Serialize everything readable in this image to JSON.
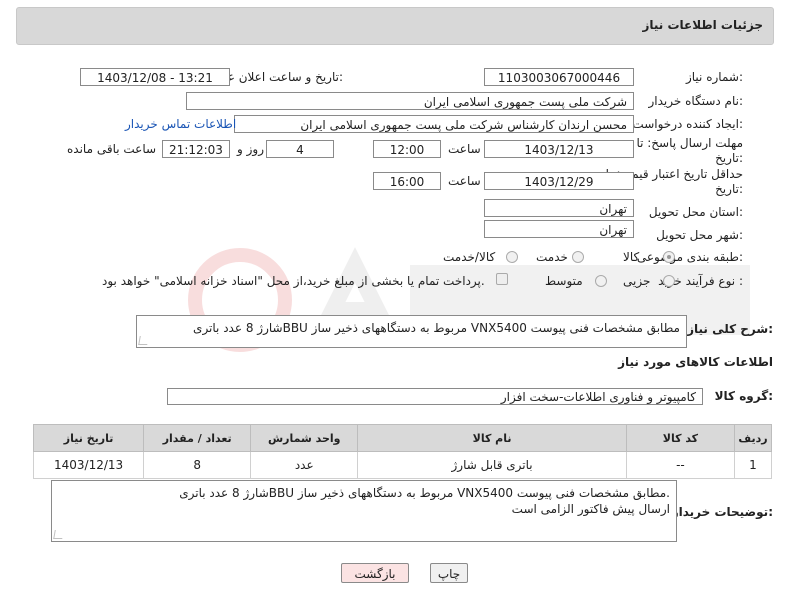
{
  "header": {
    "title": "جزئیات اطلاعات نیاز"
  },
  "fields": {
    "need_number_label": "شماره نیاز:",
    "need_number": "1103003067000446",
    "announce_label": "تاریخ و ساعت اعلان عمومی:",
    "announce_value": "1403/12/08 - 13:21",
    "buyer_label": "نام دستگاه خریدار:",
    "buyer_value": "شرکت ملی پست جمهوری اسلامی ایران",
    "requester_label": "ایجاد کننده درخواست:",
    "requester_value": "محسن ارندان کارشناس شرکت ملی پست جمهوری اسلامی ایران",
    "contact_link": "اطلاعات تماس خریدار",
    "deadline_label": "مهلت ارسال پاسخ: تا تاریخ:",
    "deadline_date": "1403/12/13",
    "time_label": "ساعت",
    "deadline_time": "12:00",
    "days_value": "4",
    "days_label": "روز و",
    "remaining_time": "21:12:03",
    "remaining_label": "ساعت باقی مانده",
    "validity_label": "حداقل تاریخ اعتبار قیمت: تا تاریخ:",
    "validity_date": "1403/12/29",
    "validity_time": "16:00",
    "province_label": "استان محل تحویل:",
    "province_value": "تهران",
    "city_label": "شهر محل تحویل:",
    "city_value": "تهران",
    "category_label": "طبقه بندی موضوعی:",
    "category_options": [
      "کالا",
      "خدمت",
      "کالا/خدمت"
    ],
    "category_selected": "کالا",
    "process_label": "نوع فرآیند خرید :",
    "process_options": [
      "جزیی",
      "متوسط"
    ],
    "payment_note": "پرداخت تمام یا بخشی از مبلغ خرید،از محل \"اسناد خزانه اسلامی\" خواهد بود."
  },
  "summary": {
    "label": "شرح کلی نیاز:",
    "text": "شارژ 8 عدد باتریBBU مربوط به دستگاههای ذخیر ساز VNX5400 مطابق مشخصات فنی پیوست"
  },
  "goods": {
    "section_title": "اطلاعات کالاهای مورد نیاز",
    "group_label": "گروه کالا:",
    "group_value": "کامپیوتر و فناوری اطلاعات-سخت افزار",
    "columns": [
      "ردیف",
      "کد کالا",
      "نام کالا",
      "واحد شمارش",
      "تعداد / مقدار",
      "تاریخ نیاز"
    ],
    "rows": [
      {
        "row": "1",
        "code": "--",
        "name": "باتری قابل شارژ",
        "unit": "عدد",
        "qty": "8",
        "date": "1403/12/13"
      }
    ]
  },
  "buyer_notes": {
    "label": "توضیحات خریدار:",
    "line1": "شارژ 8 عدد باتریBBU مربوط به دستگاههای ذخیر ساز VNX5400 مطابق مشخصات فنی پیوست.",
    "line2": "ارسال پیش فاکتور الزامی است"
  },
  "buttons": {
    "print": "چاپ",
    "back": "بازگشت"
  },
  "colors": {
    "header_bg": "#d8d8d8",
    "link": "#1a55b5",
    "back_button_bg": "#fbe3e3"
  }
}
